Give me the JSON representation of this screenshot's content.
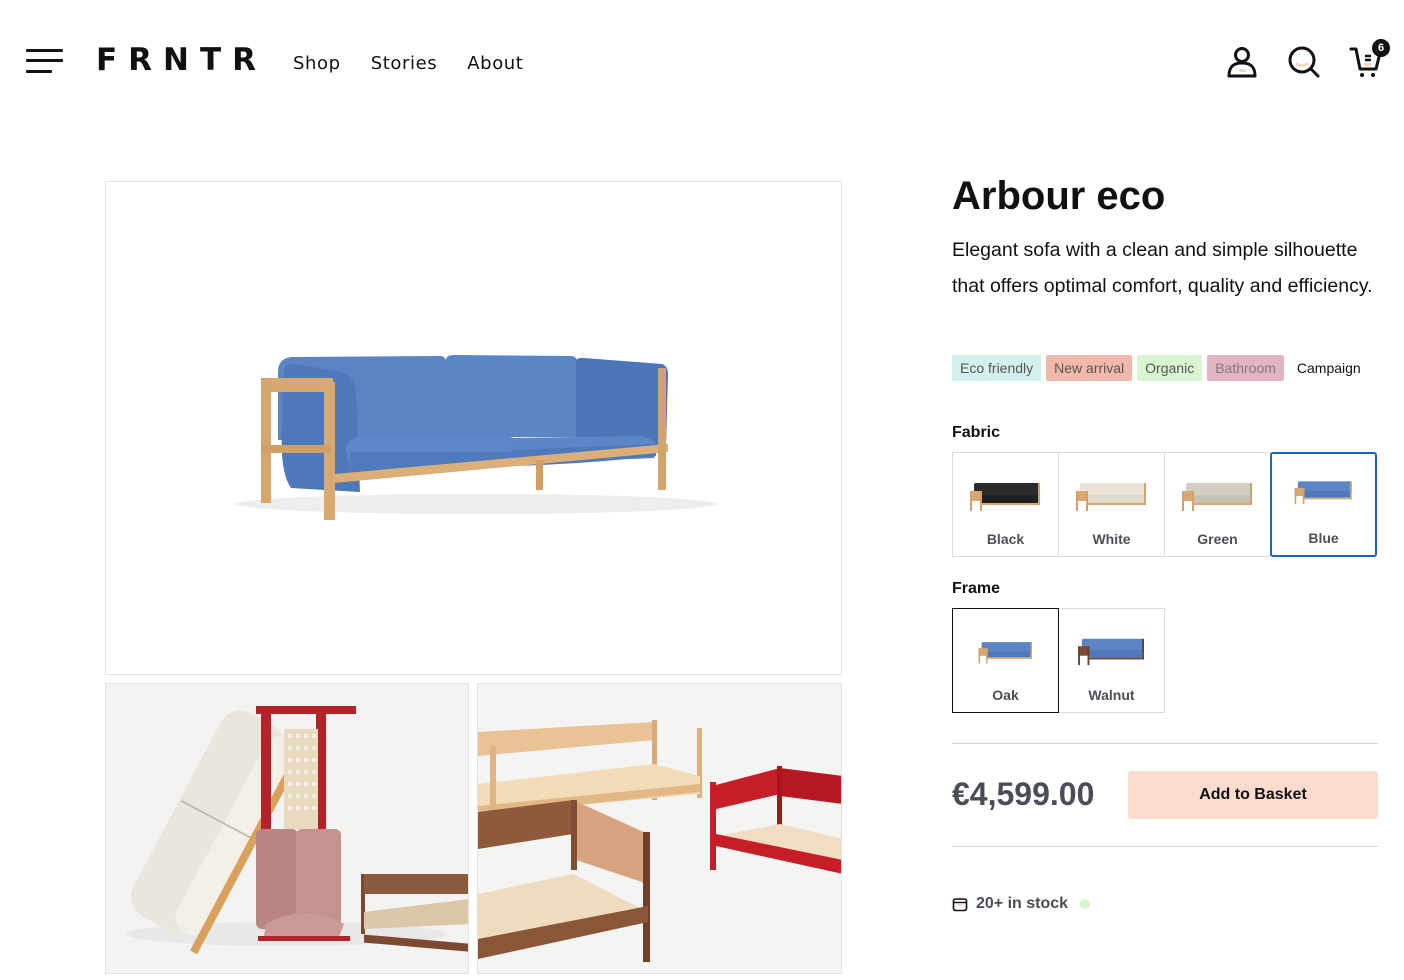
{
  "brand": "FRNTR",
  "nav": {
    "items": [
      {
        "label": "Shop"
      },
      {
        "label": "Stories"
      },
      {
        "label": "About"
      }
    ]
  },
  "header_icons": {
    "account": "user-icon",
    "search": "search-icon",
    "cart": "cart-icon",
    "cart_count": "6"
  },
  "gallery": {
    "main_alt": "Blue Arbour eco sofa with oak frame",
    "thumbs": [
      "Sofa, chair and daybed lifestyle scene",
      "Daybed frames in oak, walnut and red"
    ]
  },
  "product": {
    "title": "Arbour eco",
    "description": "Elegant sofa with a clean and simple silhouette that offers optimal comfort, quality and efficiency.",
    "tags": [
      {
        "label": "Eco friendly",
        "color": "#d3f0ec"
      },
      {
        "label": "New arrival",
        "color": "#f2b9aa"
      },
      {
        "label": "Organic",
        "color": "#daf5d2"
      },
      {
        "label": "Bathroom",
        "color": "#e2b5c3"
      },
      {
        "label": "Campaign",
        "color": ""
      }
    ],
    "fabric": {
      "label": "Fabric",
      "selected": "Blue",
      "options": [
        {
          "label": "Black",
          "color": "#2a2b2d"
        },
        {
          "label": "White",
          "color": "#e9e2d6"
        },
        {
          "label": "Green",
          "color": "#d2cbbf"
        },
        {
          "label": "Blue",
          "color": "#5b85c5"
        }
      ]
    },
    "frame": {
      "label": "Frame",
      "selected": "Oak",
      "options": [
        {
          "label": "Oak",
          "color": "#d9a86c"
        },
        {
          "label": "Walnut",
          "color": "#7a4a32"
        }
      ]
    },
    "price": "€4,599.00",
    "add_to_basket": "Add to Basket",
    "stock": "20+ in stock",
    "stock_status_color": "#d6f5cf"
  },
  "colors": {
    "accent_blue": "#1d63c0",
    "button_bg": "#fbdccf",
    "price_text": "#4a4d55"
  }
}
